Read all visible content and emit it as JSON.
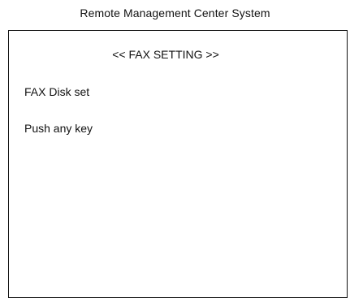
{
  "app": {
    "title": "Remote Management Center System"
  },
  "screen": {
    "heading": "<< FAX SETTING >>",
    "lines": [
      "FAX Disk set",
      "Push any key"
    ]
  }
}
